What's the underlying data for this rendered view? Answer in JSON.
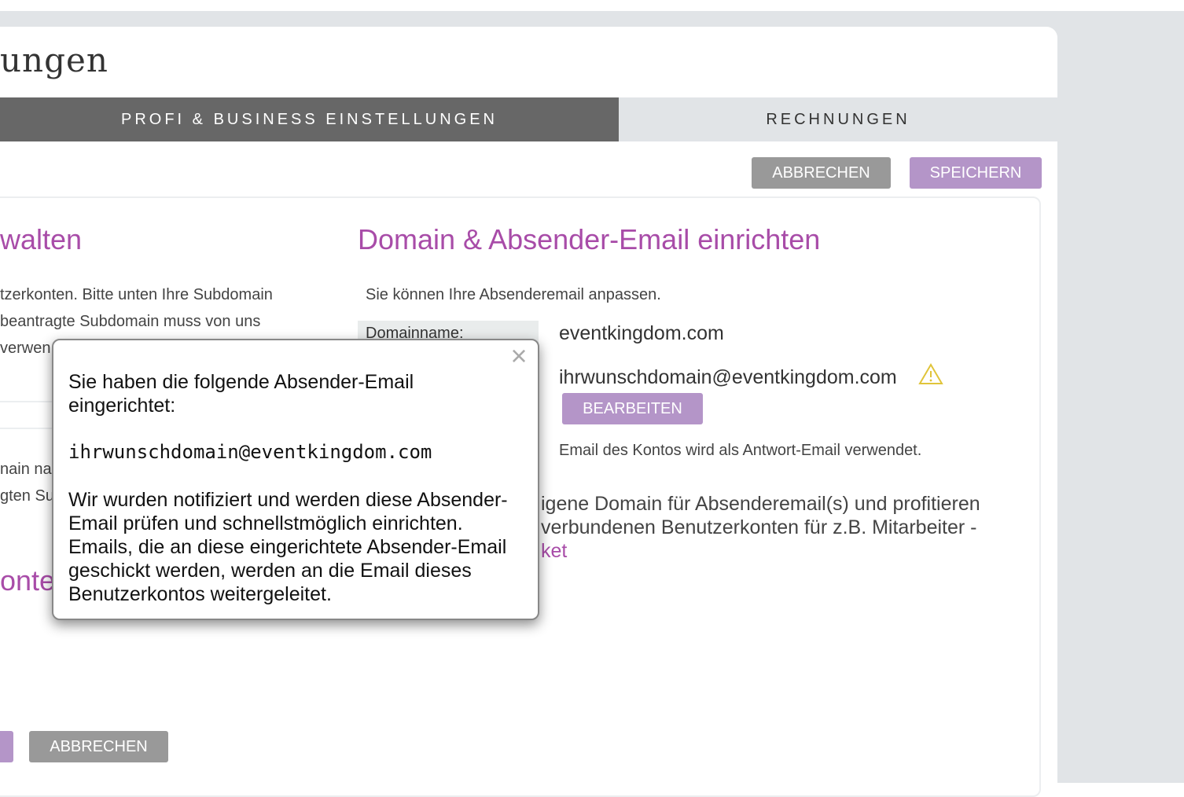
{
  "page": {
    "title": "ungen"
  },
  "tabs": [
    {
      "label": "PROFI & BUSINESS EINSTELLUNGEN",
      "active": true
    },
    {
      "label": "RECHNUNGEN",
      "active": false
    }
  ],
  "toolbar": {
    "cancel_label": "ABBRECHEN",
    "save_label": "SPEICHERN"
  },
  "left": {
    "heading": "walten",
    "lines": [
      "tzerkonten. Bitte unten Ihre Subdomain",
      "beantragte Subdomain muss von uns",
      "verwen"
    ],
    "lines2": [
      "nain na",
      "gten Su"
    ],
    "heading2": "onter",
    "cancel_label": "ABBRECHEN"
  },
  "domain": {
    "heading": "Domain & Absender-Email einrichten",
    "intro": "Sie können Ihre Absenderemail anpassen.",
    "domain_label": "Domainname:",
    "domain_value": "eventkingdom.com",
    "email_value": "ihrwunschdomain@eventkingdom.com",
    "edit_label": "BEARBEITEN",
    "reply_note": "Email des Kontos wird als Antwort-Email verwendet.",
    "promo_line1": "igene Domain für Absenderemail(s) und profitieren",
    "promo_line2": "verbundenen Benutzerkonten für z.B. Mitarbeiter -",
    "promo_link": "ket"
  },
  "popup": {
    "intro": "Sie haben die folgende Absender-Email eingerichtet:",
    "email": "ihrwunschdomain@eventkingdom.com",
    "body": "Wir wurden notifiziert und werden diese Absender-Email prüfen und schnellstmöglich einrichten. Emails, die an diese eingerichtete Absender-Email geschickt werden, werden an die Email dieses Benutzerkontos weitergeleitet.",
    "close_glyph": "×"
  },
  "colors": {
    "accent": "#a84ca8",
    "button_purple": "#b495c8",
    "button_gray": "#999999",
    "tab_active": "#676767",
    "warning": "#e0c43a"
  }
}
